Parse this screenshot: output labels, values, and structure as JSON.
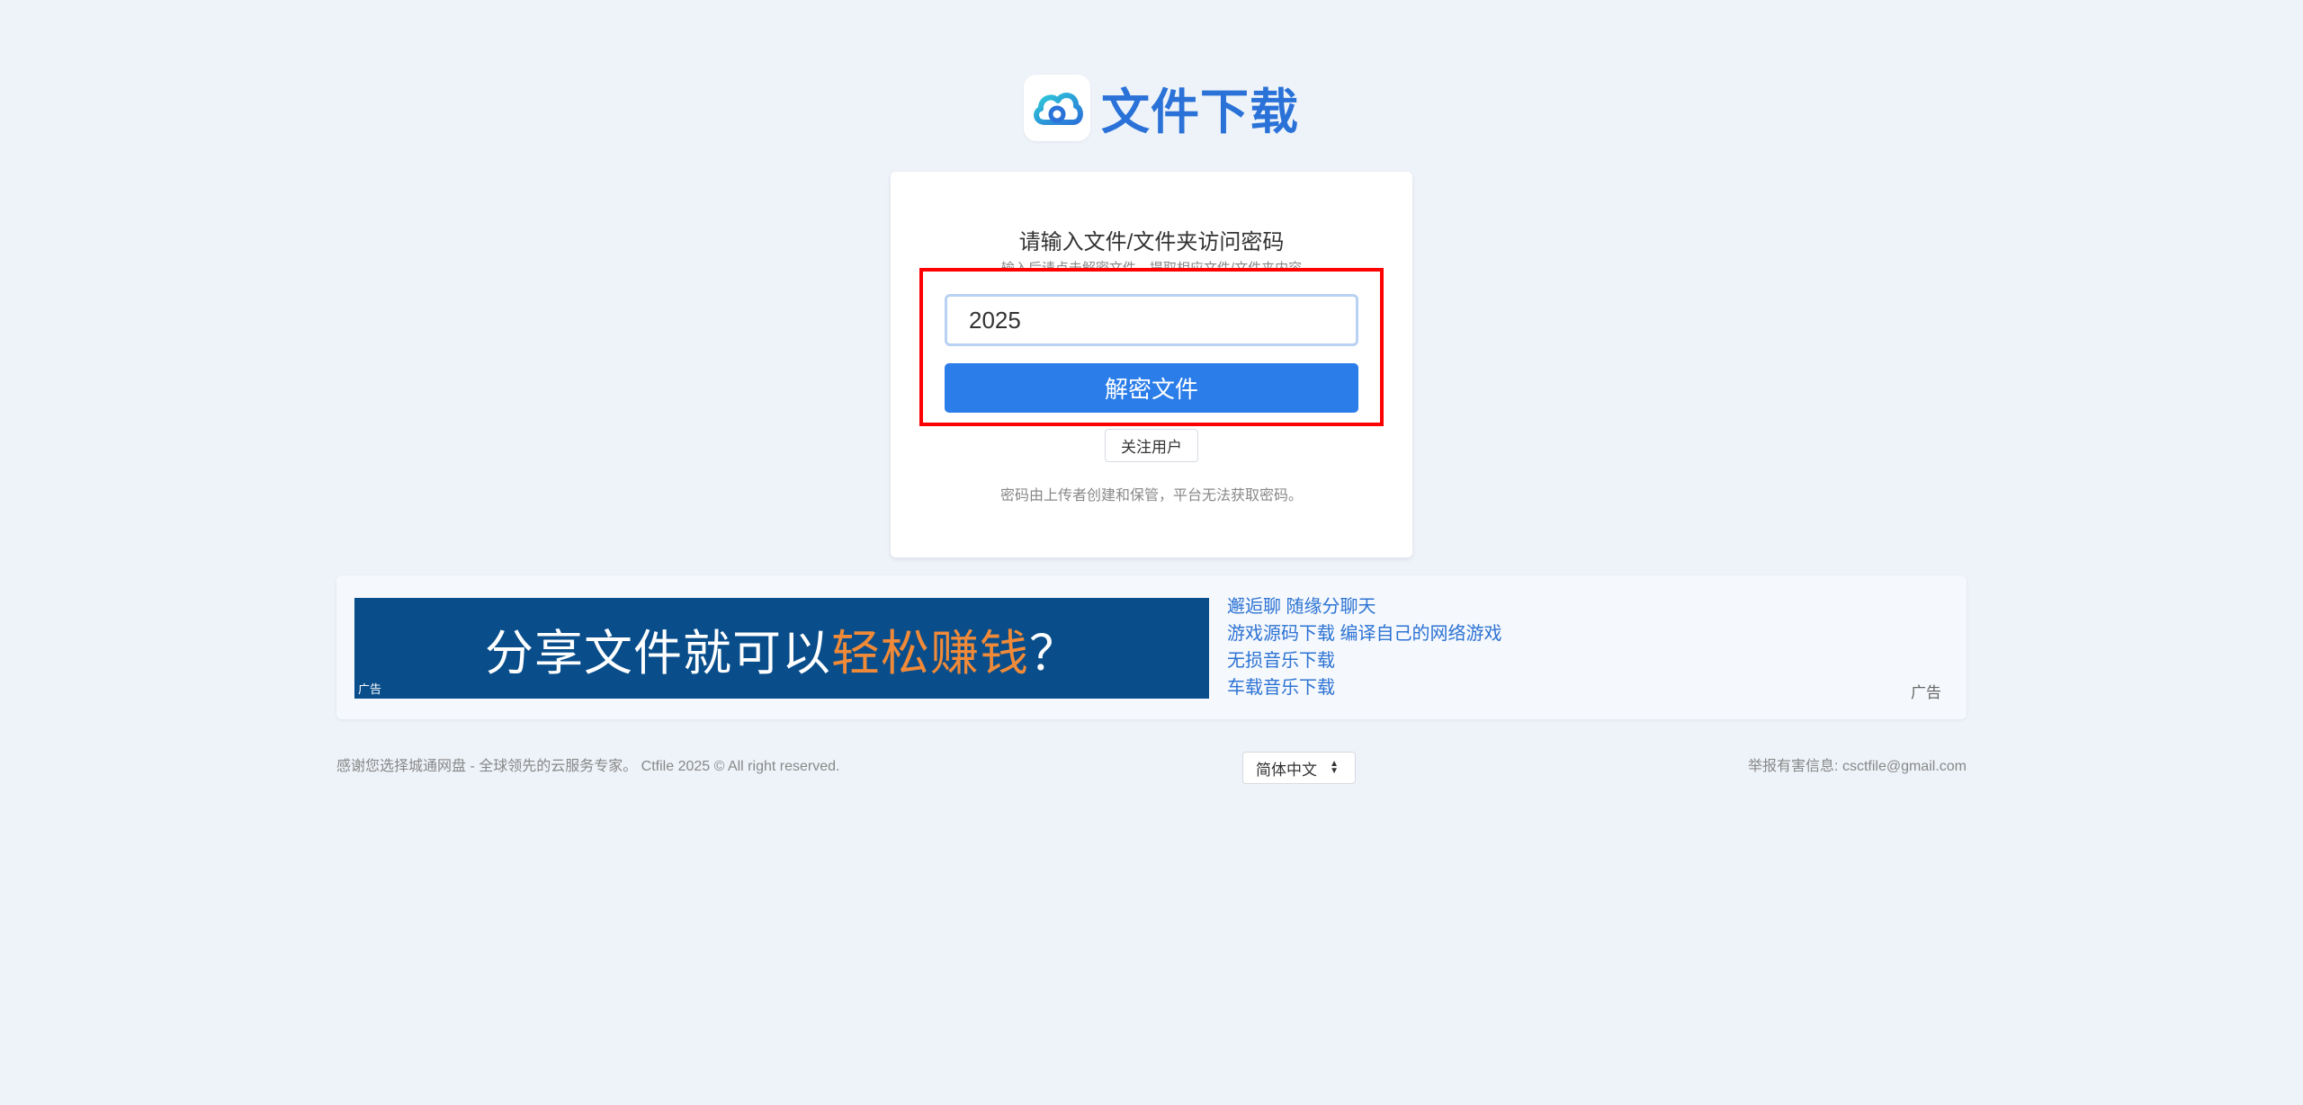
{
  "header": {
    "title": "文件下载"
  },
  "card": {
    "title": "请输入文件/文件夹访问密码",
    "subtitle": "输入后请点击解密文件，提取相应文件/文件夹内容",
    "password_value": "2025",
    "decrypt_label": "解密文件",
    "follow_label": "关注用户",
    "note": "密码由上传者创建和保管，平台无法获取密码。"
  },
  "ad": {
    "banner_text_main": "分享文件就可以",
    "banner_text_accent": "轻松赚钱",
    "banner_text_end": "？",
    "banner_tag": "广告",
    "links": [
      "邂逅聊 随缘分聊天",
      "游戏源码下载 编译自己的网络游戏",
      "无损音乐下载",
      "车载音乐下载"
    ],
    "label": "广告"
  },
  "footer": {
    "left_text": "感谢您选择城通网盘 - 全球领先的云服务专家。 Ctfile 2025 © All right reserved.",
    "language": "简体中文",
    "right_text": "举报有害信息: csctfile@gmail.com"
  },
  "colors": {
    "brand": "#2a72d8",
    "button": "#2b7de9",
    "highlight": "#ff0000",
    "ad_bg": "#094e8b",
    "ad_accent": "#f08a38"
  }
}
